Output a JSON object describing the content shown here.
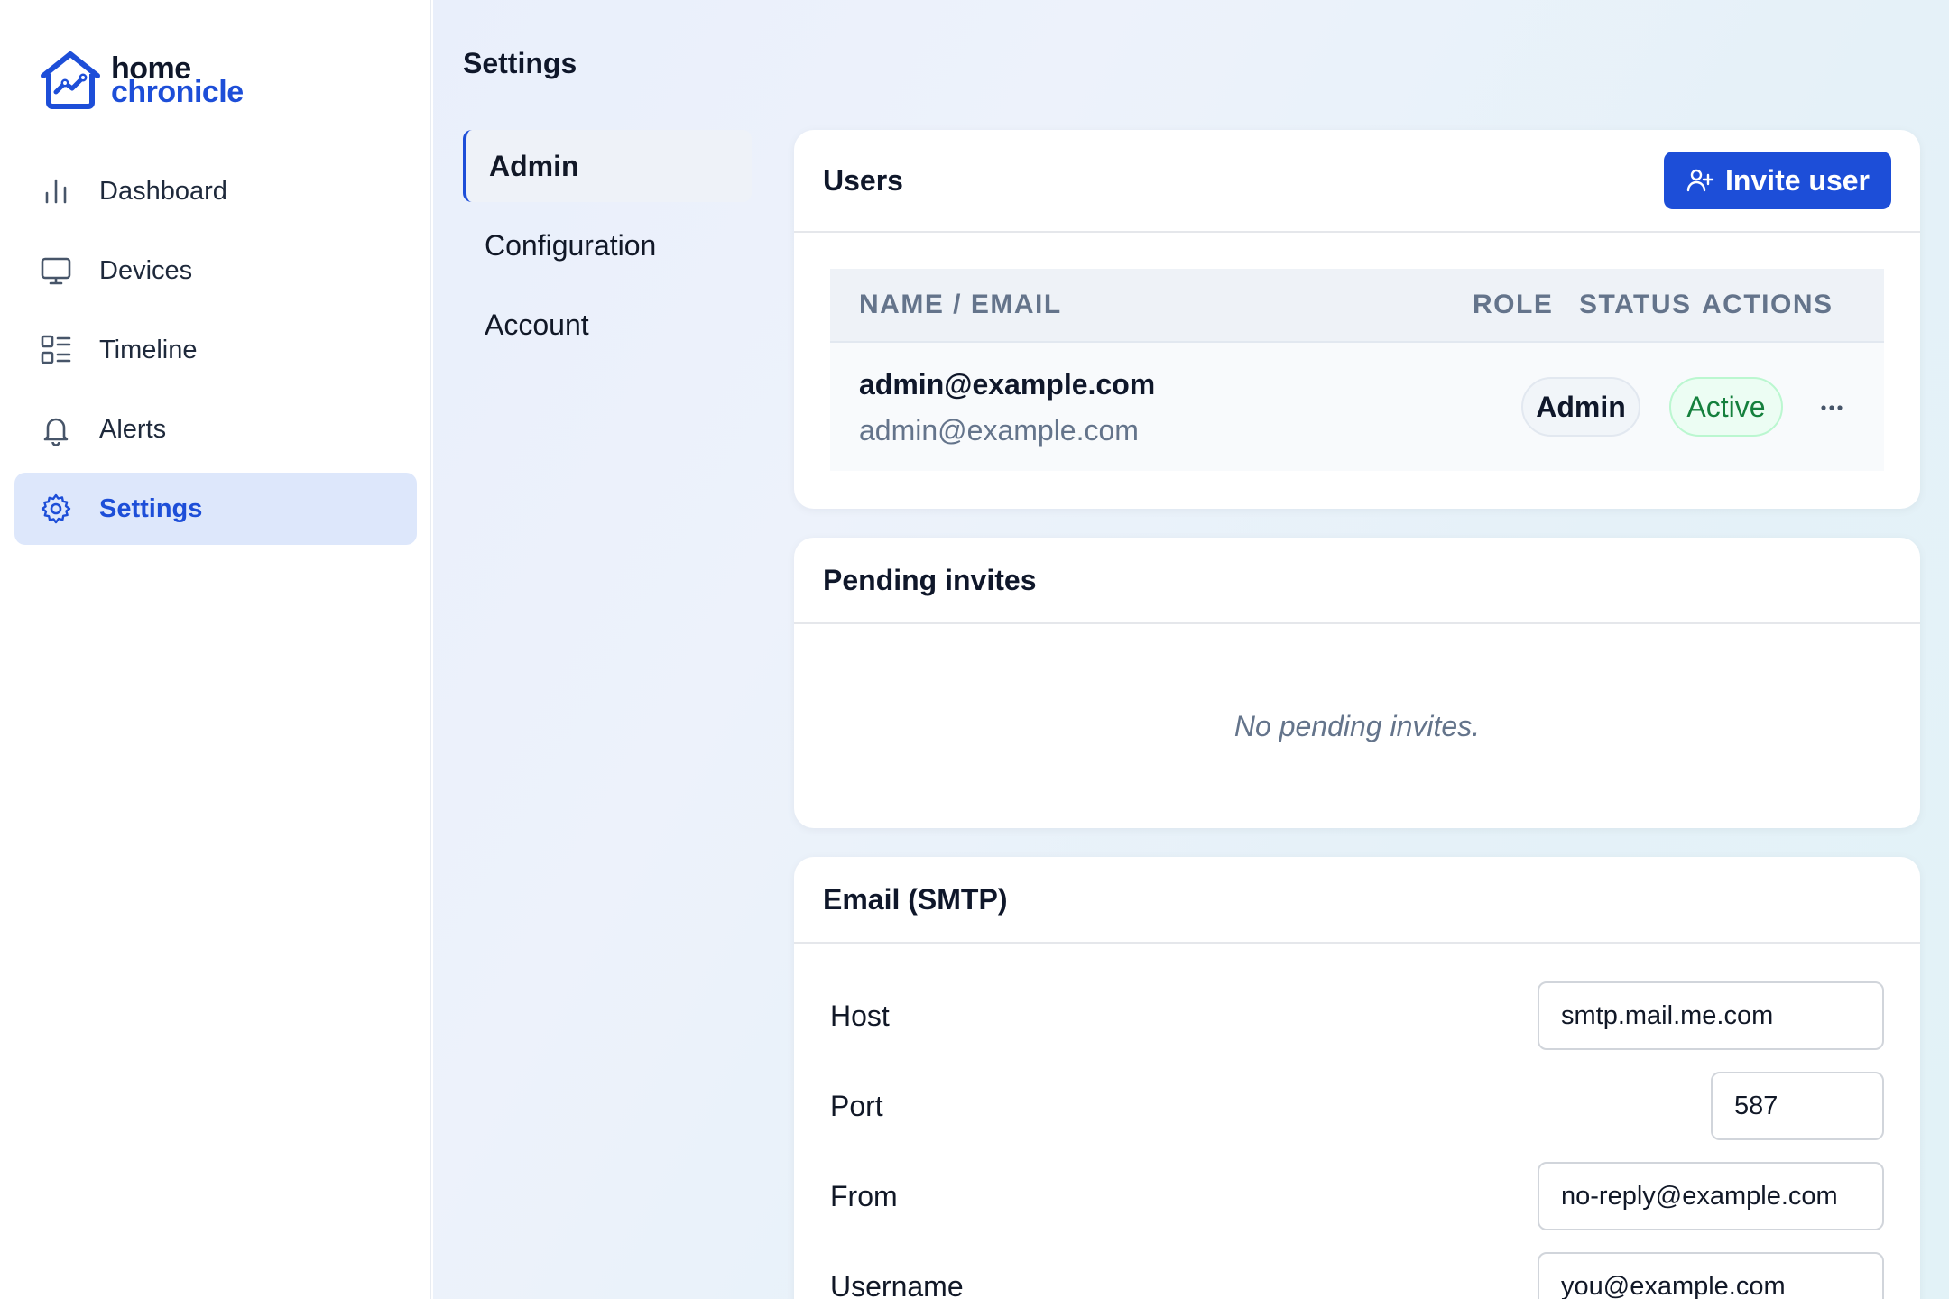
{
  "brand": {
    "line1": "home",
    "line2": "chronicle"
  },
  "sidebar": {
    "items": [
      {
        "label": "Dashboard",
        "icon": "bar-chart-icon"
      },
      {
        "label": "Devices",
        "icon": "monitor-icon"
      },
      {
        "label": "Timeline",
        "icon": "list-grid-icon"
      },
      {
        "label": "Alerts",
        "icon": "bell-icon"
      },
      {
        "label": "Settings",
        "icon": "gear-icon",
        "active": true
      }
    ]
  },
  "page": {
    "title": "Settings"
  },
  "subnav": {
    "items": [
      {
        "label": "Admin",
        "active": true
      },
      {
        "label": "Configuration"
      },
      {
        "label": "Account"
      }
    ]
  },
  "users": {
    "title": "Users",
    "invite_label": "Invite user",
    "columns": {
      "name_email": "Name / Email",
      "role": "Role",
      "status": "Status",
      "actions": "Actions"
    },
    "rows": [
      {
        "name": "admin@example.com",
        "email": "admin@example.com",
        "role": "Admin",
        "status": "Active"
      }
    ]
  },
  "pending": {
    "title": "Pending invites",
    "empty_text": "No pending invites."
  },
  "smtp": {
    "title": "Email (SMTP)",
    "fields": {
      "host": {
        "label": "Host",
        "value": "smtp.mail.me.com"
      },
      "port": {
        "label": "Port",
        "value": "587"
      },
      "from": {
        "label": "From",
        "value": "no-reply@example.com"
      },
      "username": {
        "label": "Username",
        "value": "you@example.com"
      }
    }
  },
  "colors": {
    "accent": "#1d4ed8",
    "active_nav_bg": "#dde7fb",
    "status_active": "#15803d"
  }
}
